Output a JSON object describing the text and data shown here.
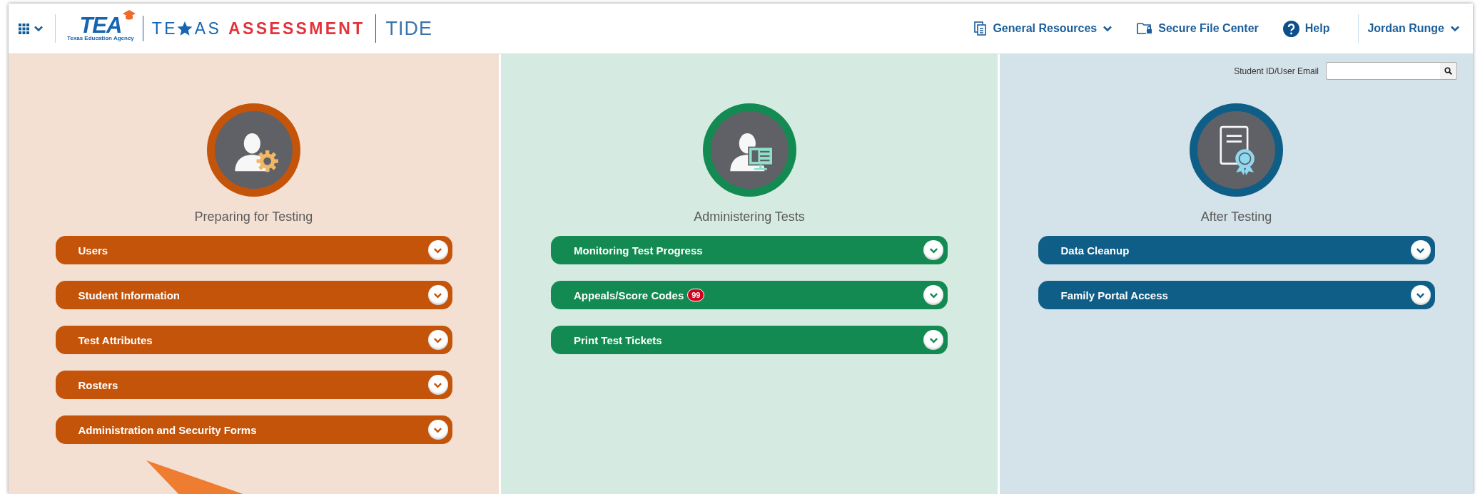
{
  "header": {
    "logo": {
      "agency": "TEA",
      "agency_name": "Texas Education Agency",
      "brand_parts": [
        "TE",
        "AS"
      ],
      "brand_accent": "ASSESSMENT"
    },
    "app_name": "TIDE",
    "nav": [
      {
        "kind": "resources",
        "label": "General Resources",
        "dropdown": true
      },
      {
        "kind": "secure-files",
        "label": "Secure File Center",
        "dropdown": false
      },
      {
        "kind": "help",
        "label": "Help",
        "dropdown": false
      }
    ],
    "user": {
      "name": "Jordan Runge"
    }
  },
  "search": {
    "label": "Student ID/User Email"
  },
  "columns": [
    {
      "title": "Preparing for Testing",
      "kind": "user-settings",
      "color": "#c4540a",
      "items": [
        {
          "label": "Users"
        },
        {
          "label": "Student Information"
        },
        {
          "label": "Test Attributes"
        },
        {
          "label": "Rosters"
        },
        {
          "label": "Administration and Security Forms"
        }
      ]
    },
    {
      "title": "Administering Tests",
      "kind": "user-monitor",
      "color": "#138a52",
      "items": [
        {
          "label": "Monitoring Test Progress"
        },
        {
          "label": "Appeals/Score Codes",
          "badge": "99"
        },
        {
          "label": "Print Test Tickets"
        }
      ]
    },
    {
      "title": "After Testing",
      "kind": "certificate",
      "color": "#0f5e87",
      "items": [
        {
          "label": "Data Cleanup"
        },
        {
          "label": "Family Portal Access"
        }
      ]
    }
  ],
  "annotation": {
    "kind": "pointer-arrow"
  }
}
